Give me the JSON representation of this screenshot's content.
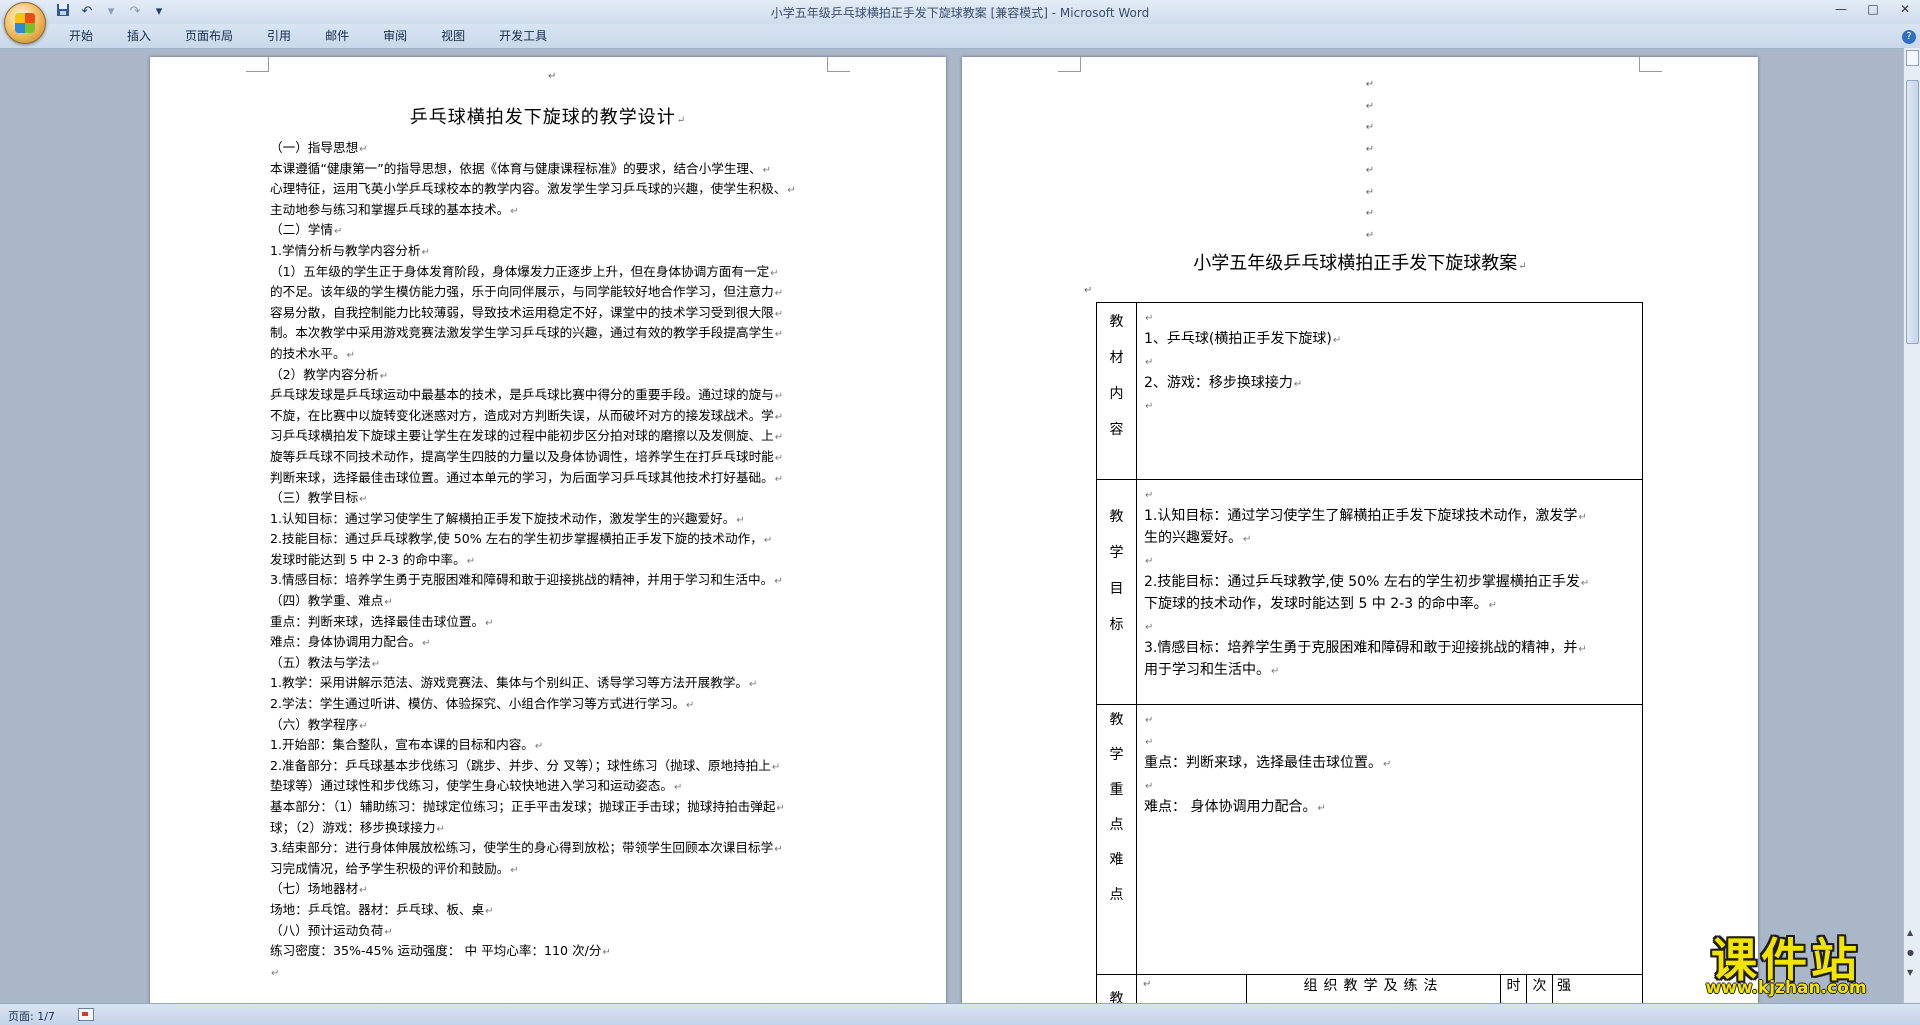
{
  "window": {
    "title": "小学五年级乒乓球横拍正手发下旋球教案 [兼容模式] - Microsoft Word",
    "controls": [
      "—",
      "□",
      "✕"
    ]
  },
  "quick_access": {
    "save_icon": "save-icon",
    "undo_glyph": "↶",
    "redo_glyph": "↷",
    "customize_glyph": "▾"
  },
  "ribbon": {
    "tabs": [
      "开始",
      "插入",
      "页面布局",
      "引用",
      "邮件",
      "审阅",
      "视图",
      "开发工具"
    ],
    "help_glyph": "?"
  },
  "page1": {
    "title": "乒乓球横拍发下旋球的教学设计",
    "para_mark": "↵",
    "lines": [
      "（一）指导思想",
      "本课遵循“健康第一”的指导思想，依据《体育与健康课程标准》的要求，结合小学生理、",
      "心理特征，运用飞英小学乒乓球校本的教学内容。激发学生学习乒乓球的兴趣，使学生积极、",
      "主动地参与练习和掌握乒乓球的基本技术。",
      "（二）学情",
      "1.学情分析与教学内容分析",
      "（1）五年级的学生正于身体发育阶段，身体爆发力正逐步上升，但在身体协调方面有一定",
      "的不足。该年级的学生模仿能力强，乐于向同伴展示，与同学能较好地合作学习，但注意力",
      "容易分散，自我控制能力比较薄弱，导致技术运用稳定不好，课堂中的技术学习受到很大限",
      "制。本次教学中采用游戏竞赛法激发学生学习乒乓球的兴趣，通过有效的教学手段提高学生",
      "的技术水平。",
      "（2）教学内容分析",
      "乒乓球发球是乒乓球运动中最基本的技术，是乒乓球比赛中得分的重要手段。通过球的旋与",
      "不旋，在比赛中以旋转变化迷惑对方，造成对方判断失误，从而破坏对方的接发球战术。学",
      "习乒乓球横拍发下旋球主要让学生在发球的过程中能初步区分拍对球的磨擦以及发侧旋、上",
      "旋等乒乓球不同技术动作，提高学生四肢的力量以及身体协调性，培养学生在打乒乓球时能",
      "判断来球，选择最佳击球位置。通过本单元的学习，为后面学习乒乓球其他技术打好基础。",
      "（三）教学目标",
      "1.认知目标：通过学习使学生了解横拍正手发下旋技术动作，激发学生的兴趣爱好。",
      "2.技能目标：通过乒乓球教学,使 50% 左右的学生初步掌握横拍正手发下旋的技术动作，",
      "发球时能达到 5 中 2-3 的命中率。",
      "3.情感目标：培养学生勇于克服困难和障碍和敢于迎接挑战的精神，并用于学习和生活中。",
      "（四）教学重、难点",
      "重点：判断来球，选择最佳击球位置。",
      "难点：身体协调用力配合。",
      "（五）教法与学法",
      "1.教学：采用讲解示范法、游戏竞赛法、集体与个别纠正、诱导学习等方法开展教学。",
      "2.学法：学生通过听讲、模仿、体验探究、小组合作学习等方式进行学习。",
      "（六）教学程序",
      "1.开始部：集合整队，宣布本课的目标和内容。",
      "2.准备部分：乒乓球基本步伐练习（跳步、并步、分 叉等）；球性练习（抛球、原地持拍上",
      "垫球等）通过球性和步伐练习，使学生身心较快地进入学习和运动姿态。",
      "基本部分：（1）辅助练习：抛球定位练习；正手平击发球；抛球正手击球；抛球持拍击弹起",
      "球；（2）游戏：移步换球接力",
      "3.结束部分：进行身体伸展放松练习，使学生的身心得到放松；带领学生回顾本次课目标学",
      "习完成情况，给予学生积极的评价和鼓励。",
      "（七）场地器材",
      "场地：乒乓馆。器材：乒乓球、板、桌",
      "（八）预计运动负荷",
      "练习密度：35%-45%                运动强度：  中          平均心率：110 次/分",
      ""
    ]
  },
  "page2": {
    "title": "小学五年级乒乓球横拍正手发下旋球教案",
    "rows": [
      {
        "label": [
          "教",
          "材",
          "内",
          "容"
        ],
        "lines": [
          "",
          "1、乒乓球(横拍正手发下旋球)",
          "",
          "2、游戏：移步换球接力",
          ""
        ]
      },
      {
        "label": [
          "教",
          "学",
          "目",
          "标"
        ],
        "lines": [
          "",
          "1.认知目标：通过学习使学生了解横拍正手发下旋球技术动作，激发学",
          "生的兴趣爱好。",
          "",
          "2.技能目标：通过乒乓球教学,使 50% 左右的学生初步掌握横拍正手发",
          "下旋球的技术动作，发球时能达到 5 中 2-3 的命中率。",
          "",
          "3.情感目标：培养学生勇于克服困难和障碍和敢于迎接挑战的精神，并",
          "用于学习和生活中。"
        ]
      },
      {
        "label": [
          "教",
          "学",
          "重",
          "点",
          "难",
          "点"
        ],
        "lines": [
          "",
          "",
          "重点：判断来球，选择最佳击球位置。",
          "",
          "难点：  身体协调用力配合。"
        ]
      }
    ],
    "footer_row": {
      "label": "教",
      "org_header": "组织教学及练法",
      "time": "时",
      "count": "次",
      "intensity": "强"
    }
  },
  "status": {
    "page_label": "页面: 1/7"
  },
  "watermark": {
    "main": "课件站",
    "url": "www.kjzhan.com"
  }
}
